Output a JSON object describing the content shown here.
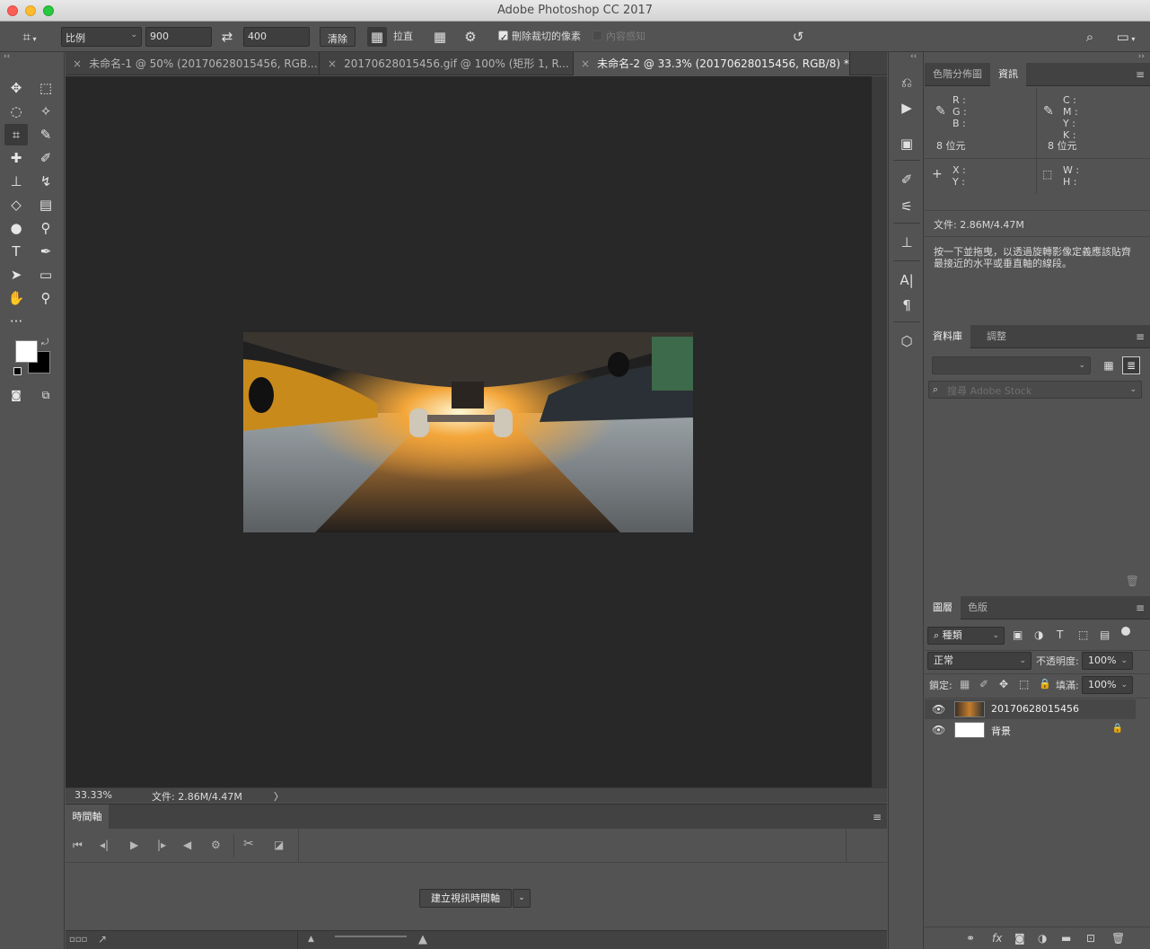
{
  "window": {
    "title": "Adobe Photoshop CC 2017"
  },
  "options_bar": {
    "ratio": "比例",
    "width": "900",
    "height": "400",
    "clear": "清除",
    "straighten": "拉直",
    "delete_cropped": "刪除裁切的像素",
    "content_aware": "內容感知"
  },
  "tabs": [
    {
      "label": "未命名-1 @ 50% (20170628015456, RGB..."
    },
    {
      "label": "20170628015456.gif @ 100% (矩形 1, R..."
    },
    {
      "label": "未命名-2 @ 33.3% (20170628015456, RGB/8) *"
    }
  ],
  "status": {
    "zoom": "33.33%",
    "doc": "文件: 2.86M/4.47M",
    "arrow": "〉"
  },
  "timeline": {
    "title": "時間軸",
    "create_button": "建立視訊時間軸"
  },
  "info_panel": {
    "tabs": [
      "色階分佈圖",
      "資訊"
    ],
    "rgb": [
      "R :",
      "G :",
      "B :"
    ],
    "cmyk": [
      "C :",
      "M :",
      "Y :",
      "K :"
    ],
    "bits_left": "8 位元",
    "bits_right": "8 位元",
    "xy": [
      "X :",
      "Y :"
    ],
    "wh": [
      "W :",
      "H :"
    ],
    "doc": "文件: 2.86M/4.47M",
    "hint": "按一下並拖曳，以透過旋轉影像定義應該貼齊最接近的水平或垂直軸的線段。"
  },
  "library_panel": {
    "tabs": [
      "資料庫",
      "調整"
    ],
    "search_placeholder": "搜尋 Adobe Stock"
  },
  "layers_panel": {
    "tabs": [
      "圖層",
      "色版"
    ],
    "filter": "種類",
    "blend": "正常",
    "opacity_label": "不透明度:",
    "opacity": "100%",
    "lock_label": "鎖定:",
    "fill_label": "填滿:",
    "fill": "100%",
    "layers": [
      {
        "name": "20170628015456"
      },
      {
        "name": "背景"
      }
    ]
  }
}
